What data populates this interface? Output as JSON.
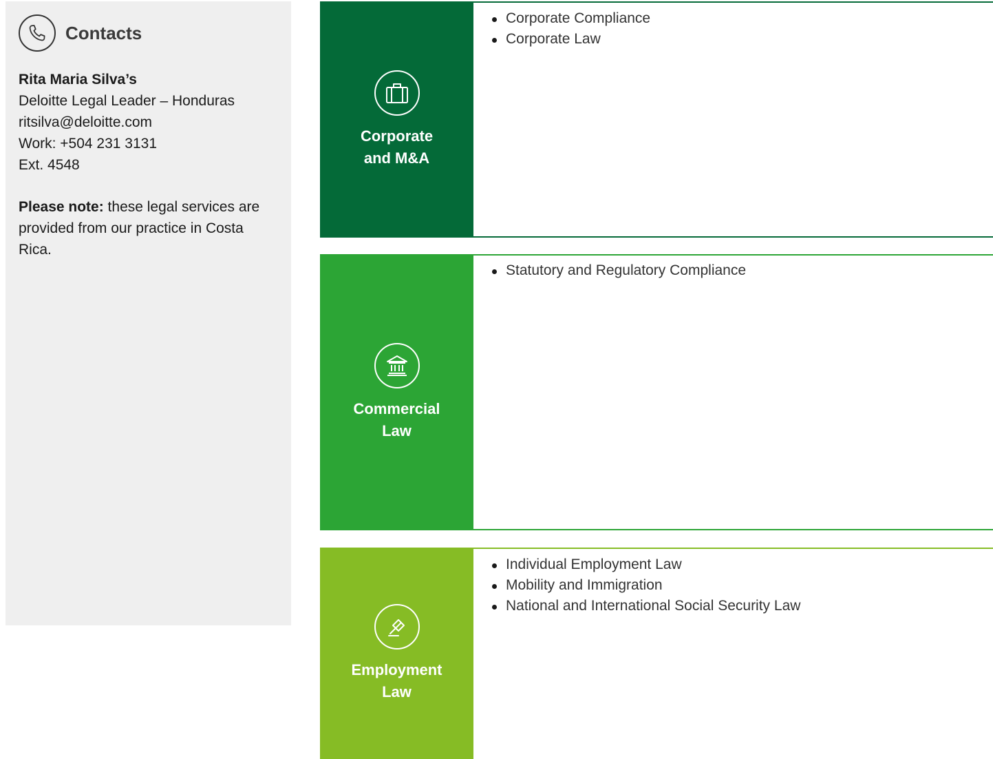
{
  "contacts": {
    "title": "Contacts",
    "name": "Rita Maria Silva’s",
    "role": "Deloitte Legal Leader – Honduras",
    "email": "ritsilva@deloitte.com",
    "work": "Work: +504 231 3131",
    "ext": "Ext. 4548",
    "note_label": "Please note:",
    "note_text": " these legal services are provided from our practice in Costa Rica."
  },
  "practices": [
    {
      "name_line1": "Corporate",
      "name_line2": "and M&A",
      "icon": "briefcase-icon",
      "color": "#046a38",
      "services": [
        "Corporate Compliance",
        "Corporate Law"
      ]
    },
    {
      "name_line1": "Commercial",
      "name_line2": "Law",
      "icon": "bank-building-icon",
      "color": "#2ca535",
      "services": [
        "Statutory and Regulatory Compliance"
      ]
    },
    {
      "name_line1": "Employment",
      "name_line2": "Law",
      "icon": "gavel-icon",
      "color": "#86bc25",
      "services": [
        "Individual Employment Law",
        "Mobility and Immigration",
        "National and International Social Security Law"
      ]
    }
  ]
}
